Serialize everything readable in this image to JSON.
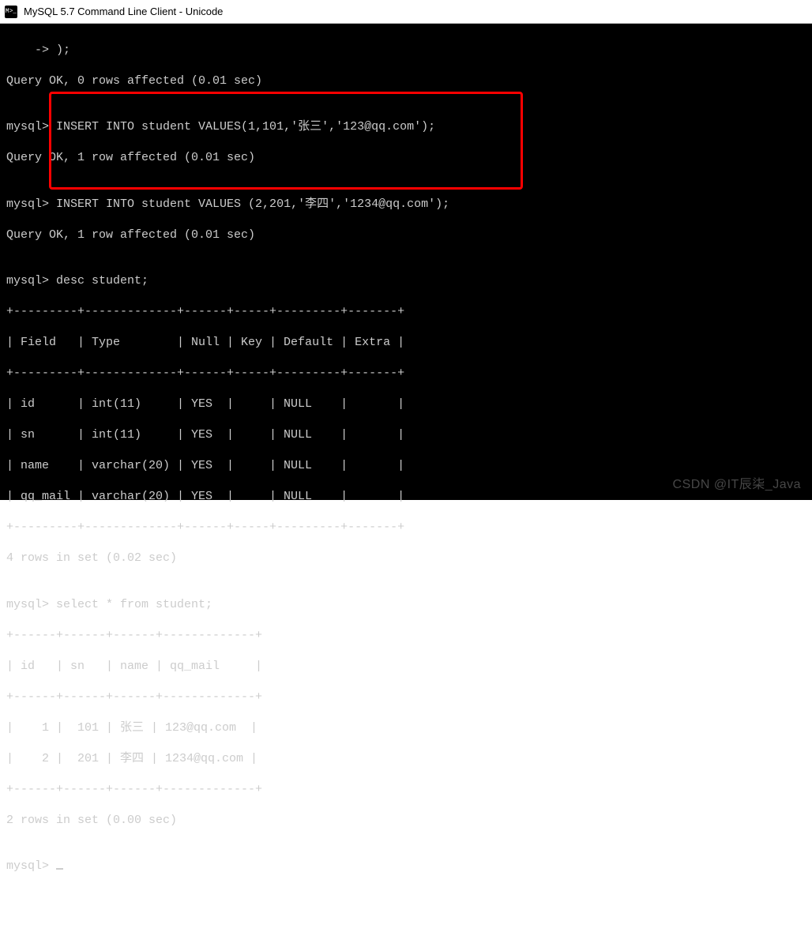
{
  "titlebar": {
    "icon_text": "M>_",
    "title": "MySQL 5.7 Command Line Client - Unicode"
  },
  "terminal": {
    "line_cont": "    -> );",
    "result_ok0": "Query OK, 0 rows affected (0.01 sec)",
    "blank": "",
    "prompt": "mysql>",
    "insert1": " INSERT INTO student VALUES(1,101,'张三','123@qq.com');",
    "result_ok1": "Query OK, 1 row affected (0.01 sec)",
    "insert2": " INSERT INTO student VALUES (2,201,'李四','1234@qq.com');",
    "result_ok2": "Query OK, 1 row affected (0.01 sec)",
    "desc_cmd": " desc student;",
    "desc_border": "+---------+-------------+------+-----+---------+-------+",
    "desc_header": "| Field   | Type        | Null | Key | Default | Extra |",
    "desc_rows": [
      "| id      | int(11)     | YES  |     | NULL    |       |",
      "| sn      | int(11)     | YES  |     | NULL    |       |",
      "| name    | varchar(20) | YES  |     | NULL    |       |",
      "| qq_mail | varchar(20) | YES  |     | NULL    |       |"
    ],
    "desc_footer": "4 rows in set (0.02 sec)",
    "select_cmd": " select * from student;",
    "sel_border": "+------+------+------+-------------+",
    "sel_header": "| id   | sn   | name | qq_mail     |",
    "sel_rows": [
      "|    1 |  101 | 张三 | 123@qq.com  |",
      "|    2 |  201 | 李四 | 1234@qq.com |"
    ],
    "sel_footer": "2 rows in set (0.00 sec)"
  },
  "watermark": "CSDN @IT辰柒_Java"
}
